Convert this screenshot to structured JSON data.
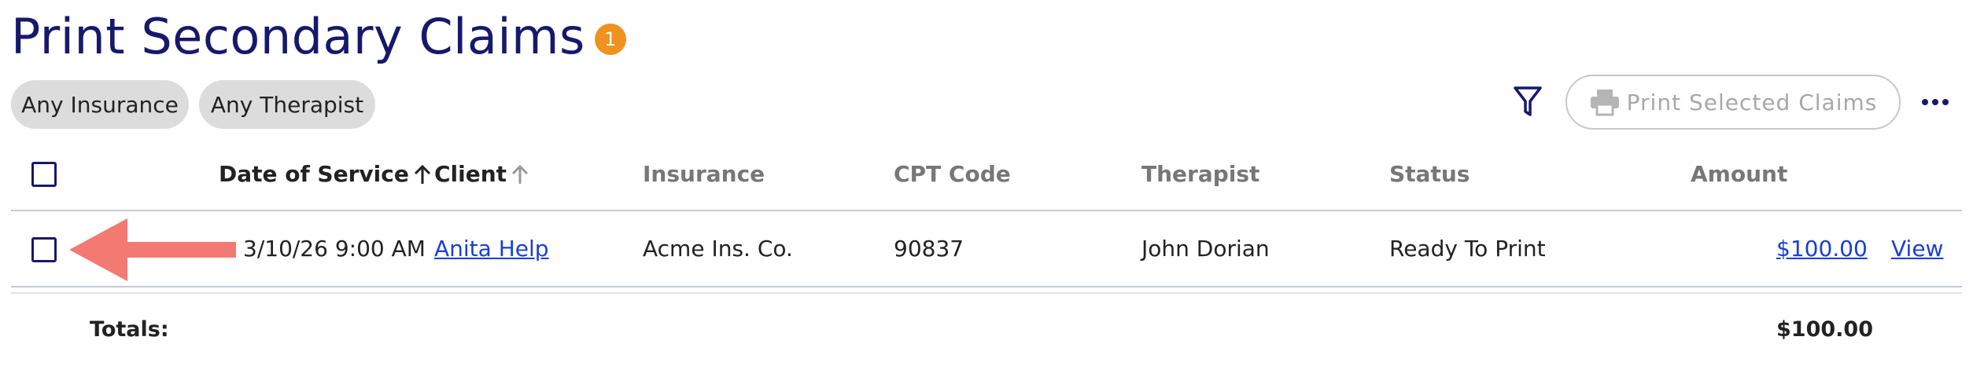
{
  "header": {
    "title": "Print Secondary Claims",
    "badge_count": "1"
  },
  "filters": {
    "insurance_label": "Any Insurance",
    "therapist_label": "Any Therapist"
  },
  "toolbar": {
    "print_label": "Print Selected Claims",
    "print_enabled": false
  },
  "table": {
    "columns": [
      "Date of Service",
      "Client",
      "Insurance",
      "CPT Code",
      "Therapist",
      "Status",
      "Amount"
    ],
    "sort_column": "Date of Service",
    "rows": [
      {
        "date": "3/10/26 9:00 AM",
        "client": "Anita Help",
        "insurance": "Acme Ins. Co.",
        "cpt": "90837",
        "therapist": "John Dorian",
        "status": "Ready To Print",
        "amount": "$100.00",
        "action": "View",
        "selected": false
      }
    ],
    "totals": {
      "label": "Totals:",
      "amount": "$100.00"
    }
  },
  "colors": {
    "title": "#16196b",
    "badge": "#f0921e",
    "link": "#1a3fd6",
    "annotation_arrow": "#f27a72"
  }
}
